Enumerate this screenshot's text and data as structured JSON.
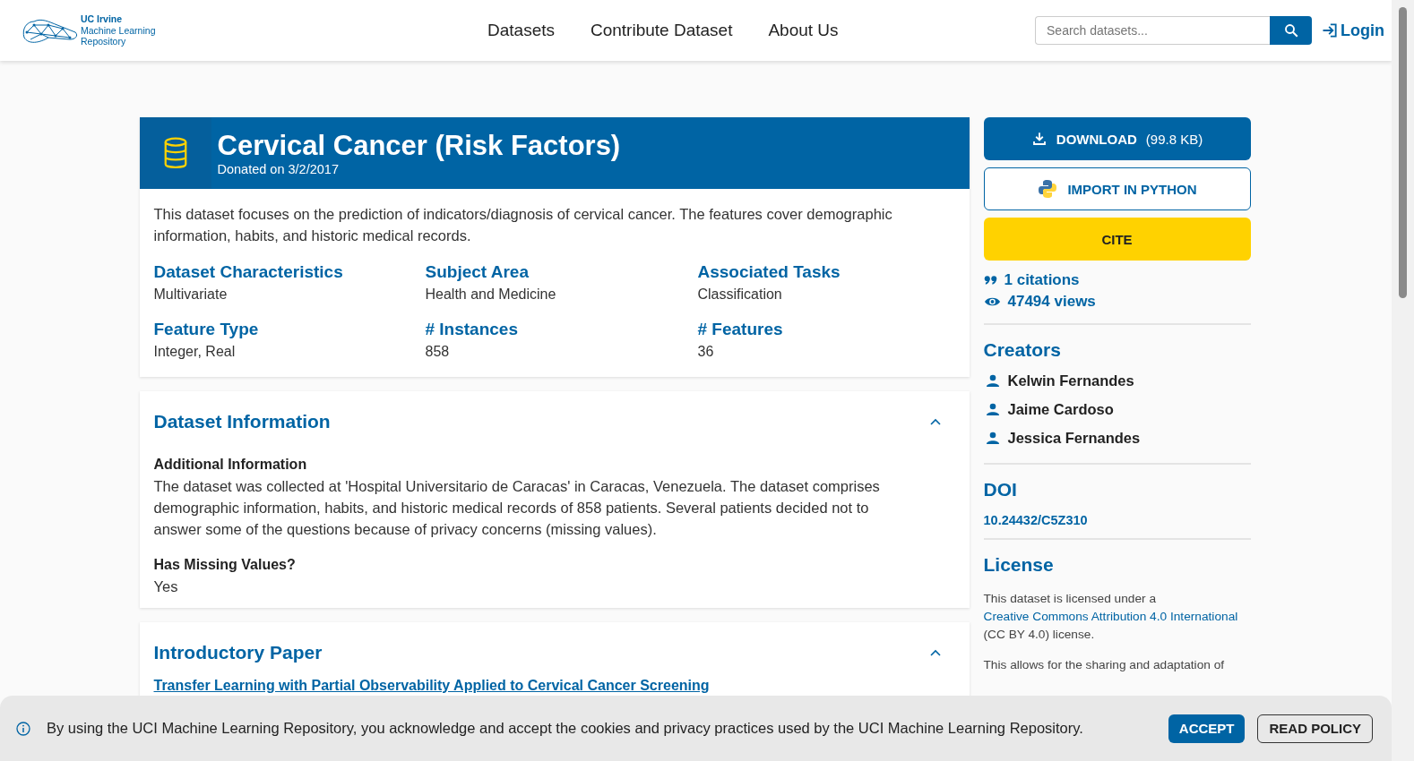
{
  "header": {
    "logo_lines": [
      "UC Irvine",
      "Machine Learning",
      "Repository"
    ],
    "nav": [
      {
        "label": "Datasets"
      },
      {
        "label": "Contribute Dataset"
      },
      {
        "label": "About Us"
      }
    ],
    "search": {
      "placeholder": "Search datasets..."
    },
    "login": "Login"
  },
  "dataset": {
    "title": "Cervical Cancer (Risk Factors)",
    "donated": "Donated on 3/2/2017",
    "description": "This dataset focuses on the prediction of indicators/diagnosis of cervical cancer. The features cover demographic information, habits, and historic medical records.",
    "characteristics": [
      {
        "label": "Dataset Characteristics",
        "value": "Multivariate"
      },
      {
        "label": "Subject Area",
        "value": "Health and Medicine"
      },
      {
        "label": "Associated Tasks",
        "value": "Classification"
      },
      {
        "label": "Feature Type",
        "value": "Integer, Real"
      },
      {
        "label": "# Instances",
        "value": "858"
      },
      {
        "label": "# Features",
        "value": "36"
      }
    ]
  },
  "sections": [
    {
      "kind": "info",
      "title": "Dataset Information",
      "expanded": true,
      "blocks": [
        {
          "heading": "Additional Information",
          "text": "The dataset was collected at 'Hospital Universitario de Caracas' in Caracas, Venezuela. The dataset comprises demographic information, habits, and historic medical records of 858 patients. Several patients decided not to answer some of the questions because of privacy concerns (missing values)."
        },
        {
          "heading": "Has Missing Values?",
          "text": "Yes"
        }
      ]
    },
    {
      "kind": "paper",
      "title": "Introductory Paper",
      "expanded": true,
      "link": "Transfer Learning with Partial Observability Applied to Cervical Cancer Screening"
    }
  ],
  "sidebar": {
    "actions": [
      {
        "kind": "download",
        "label": "DOWNLOAD",
        "note": "(99.8 KB)"
      },
      {
        "kind": "python",
        "label": "IMPORT IN PYTHON"
      },
      {
        "kind": "cite",
        "label": "CITE"
      }
    ],
    "citations": "1 citations",
    "views": "47494 views",
    "creators_title": "Creators",
    "creators": [
      "Kelwin Fernandes",
      "Jaime Cardoso",
      "Jessica Fernandes"
    ],
    "doi_title": "DOI",
    "doi": "10.24432/C5Z310",
    "license_title": "License",
    "license_parts": [
      {
        "kind": "text",
        "text": "This dataset is licensed under a "
      },
      {
        "kind": "link",
        "text": "Creative Commons Attribution 4.0 International"
      },
      {
        "kind": "text",
        "text": " (CC BY 4.0) license."
      }
    ],
    "license_more": "This allows for the sharing and adaptation of"
  },
  "cookie_banner": {
    "text": "By using the UCI Machine Learning Repository, you acknowledge and accept the cookies and privacy practices used by the UCI Machine Learning Repository.",
    "buttons": [
      {
        "kind": "primary",
        "label": "ACCEPT"
      },
      {
        "kind": "outline",
        "label": "READ POLICY"
      }
    ]
  }
}
